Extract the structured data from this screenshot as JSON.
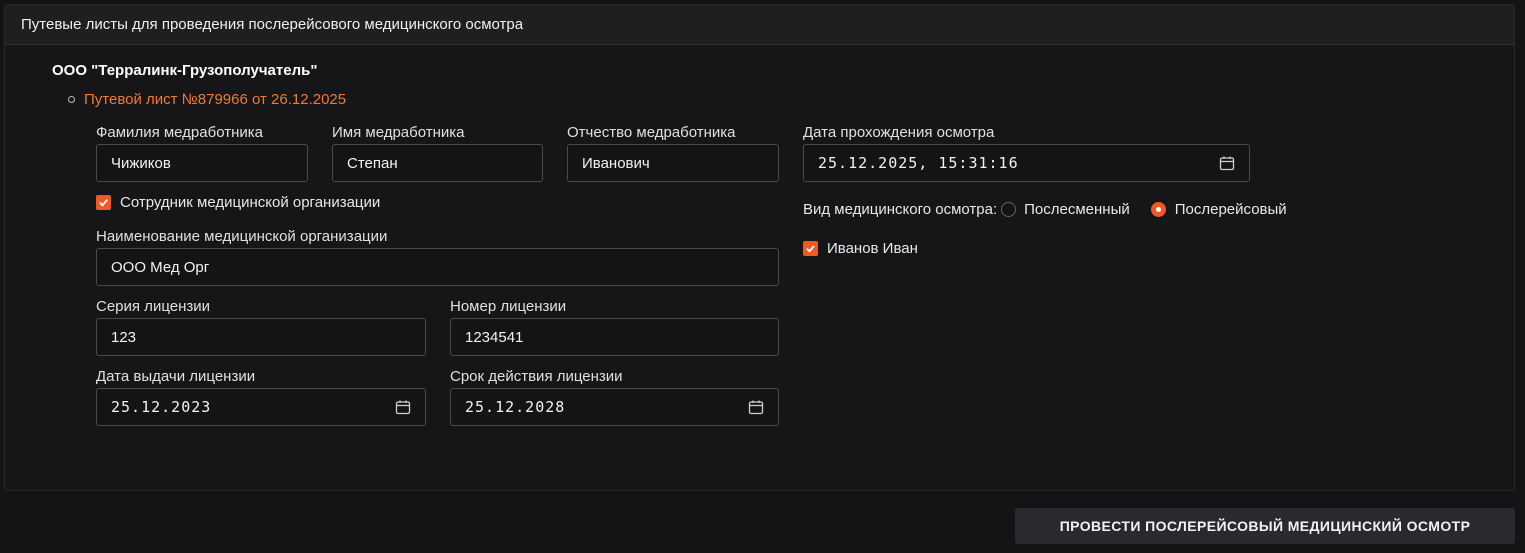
{
  "panel": {
    "title": "Путевые листы для проведения послерейсового медицинского осмотра"
  },
  "organization": {
    "name": "ООО \"Терралинк-Грузополучатель\"",
    "waybill_link": "Путевой лист №879966 от 26.12.2025"
  },
  "medic": {
    "last_name_label": "Фамилия медработника",
    "last_name_value": "Чижиков",
    "first_name_label": "Имя медработника",
    "first_name_value": "Степан",
    "patronymic_label": "Отчество медработника",
    "patronymic_value": "Иванович",
    "is_org_employee_label": "Сотрудник медицинской организации",
    "is_org_employee_checked": true,
    "org_name_label": "Наименование медицинской организации",
    "org_name_value": "ООО Мед Орг",
    "license_series_label": "Серия лицензии",
    "license_series_value": "123",
    "license_number_label": "Номер лицензии",
    "license_number_value": "1234541",
    "license_issue_date_label": "Дата выдачи лицензии",
    "license_issue_date_value": "25.12.2023",
    "license_expiry_label": "Срок действия лицензии",
    "license_expiry_value": "25.12.2028"
  },
  "exam": {
    "date_label": "Дата прохождения осмотра",
    "date_value": "25.12.2025, 15:31:16",
    "type_label": "Вид медицинского осмотра:",
    "type_options": [
      "Послесменный",
      "Послерейсовый"
    ],
    "type_selected": "Послерейсовый",
    "driver_name": "Иванов Иван",
    "driver_checked": true
  },
  "actions": {
    "submit_label": "ПРОВЕСТИ ПОСЛЕРЕЙСОВЫЙ МЕДИЦИНСКИЙ ОСМОТР"
  },
  "colors": {
    "accent": "#f05a22",
    "link": "#f07a2a",
    "background": "#141416"
  }
}
